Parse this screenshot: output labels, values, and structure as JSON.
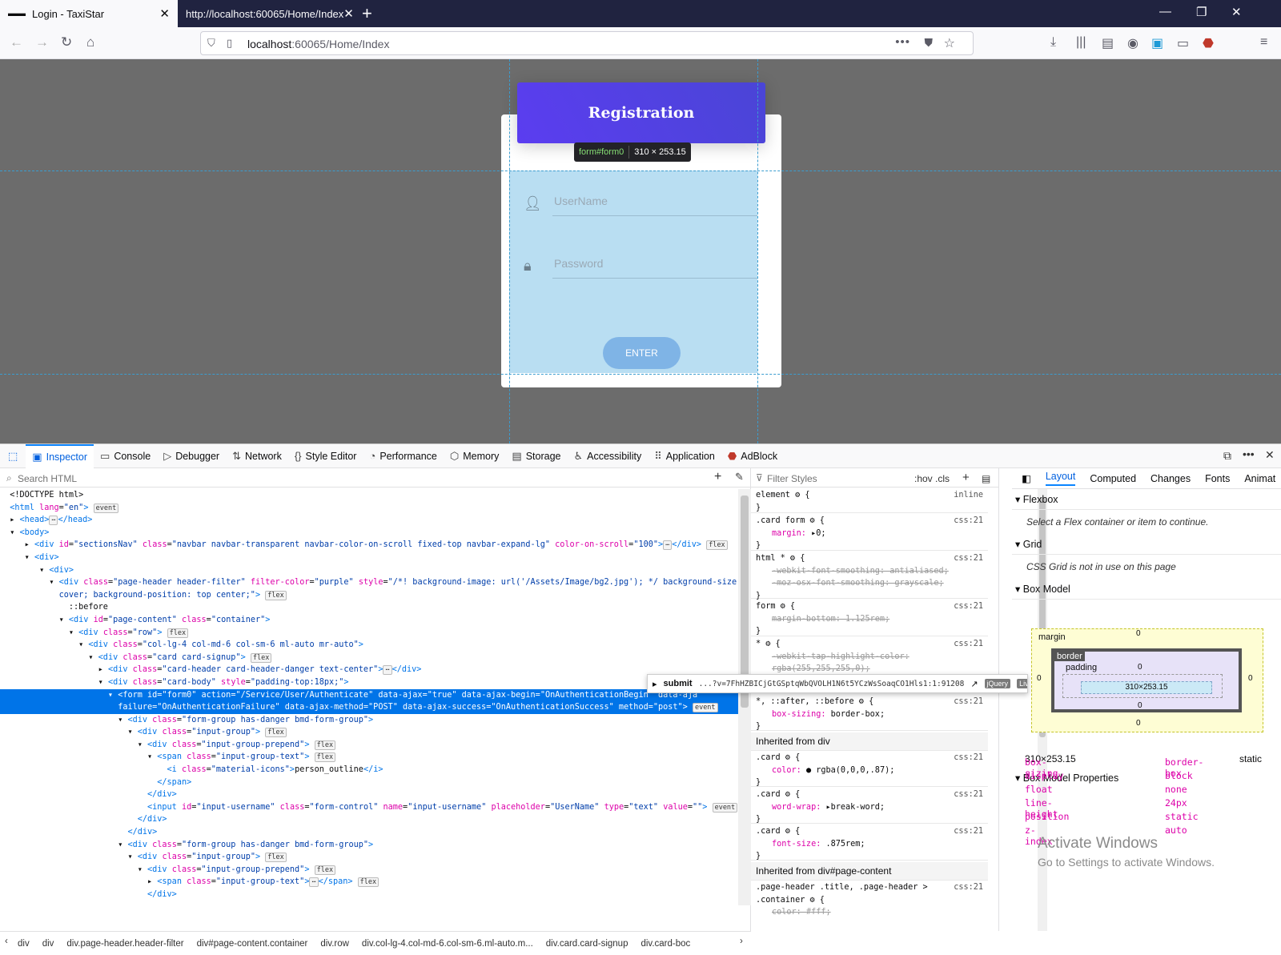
{
  "browser": {
    "tabs": [
      {
        "title": "Login - TaxiStar",
        "active": true
      },
      {
        "title": "http://localhost:60065/Home/Index",
        "active": false
      }
    ],
    "url_host": "localhost",
    "url_path": ":60065/Home/Index"
  },
  "page": {
    "card_title": "Registration",
    "username_placeholder": "UserName",
    "password_placeholder": "Password",
    "enter_label": "ENTER",
    "highlight_tag": "form#form0",
    "highlight_size": "310 × 253.15"
  },
  "devtools": {
    "tabs": [
      "Inspector",
      "Console",
      "Debugger",
      "Network",
      "Style Editor",
      "Performance",
      "Memory",
      "Storage",
      "Accessibility",
      "Application",
      "AdBlock"
    ],
    "search_placeholder": "Search HTML",
    "filter_placeholder": "Filter Styles",
    "hov": ":hov",
    "cls": ".cls",
    "layout_tabs": [
      "Layout",
      "Computed",
      "Changes",
      "Fonts",
      "Animat"
    ],
    "breadcrumbs": [
      "div",
      "div",
      "div.page-header.header-filter",
      "div#page-content.container",
      "div.row",
      "div.col-lg-4.col-md-6.col-sm-6.ml-auto.m...",
      "div.card.card-signup",
      "div.card-boc"
    ],
    "event_popup": {
      "name": "submit",
      "source": "...?v=7FhHZBICjGtGSptqWbQVOLH1N6t5YCzWsSoaqCO1Hls1:1:91208",
      "badges": [
        "jQuery",
        "Live"
      ]
    },
    "flexbox_title": "Flexbox",
    "flexbox_note": "Select a Flex container or item to continue.",
    "grid_title": "Grid",
    "grid_note": "CSS Grid is not in use on this page",
    "boxmodel_title": "Box Model",
    "boxmodel_labels": {
      "margin": "margin",
      "border": "border",
      "padding": "padding",
      "content": "310×253.15"
    },
    "boxmodel_summary": "310×253.15",
    "boxmodel_position": "static",
    "boxmodel_props_title": "Box Model Properties",
    "boxmodel_props": [
      {
        "k": "box-sizing",
        "v": "border-box"
      },
      {
        "k": "display",
        "v": "block"
      },
      {
        "k": "float",
        "v": "none"
      },
      {
        "k": "line-height",
        "v": "24px"
      },
      {
        "k": "position",
        "v": "static"
      },
      {
        "k": "z-index",
        "v": "auto"
      }
    ],
    "watermark_1": "Activate Windows",
    "watermark_2": "Go to Settings to activate Windows."
  }
}
